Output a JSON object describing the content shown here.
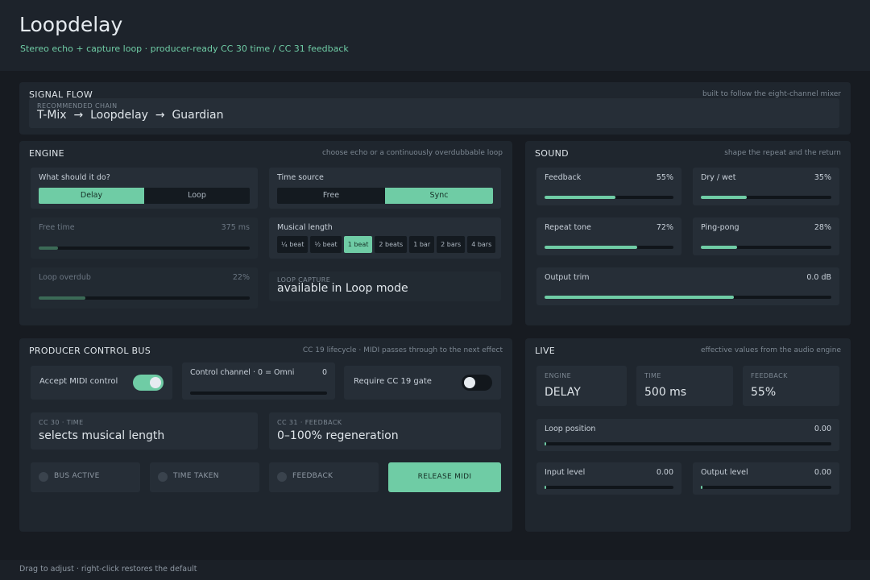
{
  "app": {
    "title": "Loopdelay",
    "subtitle": "Stereo echo + capture loop · producer-ready CC 30 time / CC 31 feedback"
  },
  "signal_flow": {
    "title": "SIGNAL FLOW",
    "hint": "built to follow the eight-channel mixer",
    "chain_label": "RECOMMENDED CHAIN",
    "chain": "T-Mix  →  Loopdelay  →  Guardian"
  },
  "engine": {
    "title": "ENGINE",
    "hint": "choose echo or a continuously overdubbable loop",
    "mode": {
      "label": "What should it do?",
      "options": [
        "Delay",
        "Loop"
      ],
      "selected": "Delay"
    },
    "time_source": {
      "label": "Time source",
      "options": [
        "Free",
        "Sync"
      ],
      "selected": "Sync"
    },
    "free_time": {
      "label": "Free time",
      "value": "375 ms",
      "level": 0.09
    },
    "musical_length": {
      "label": "Musical length",
      "options": [
        "¼ beat",
        "½ beat",
        "1 beat",
        "2 beats",
        "1 bar",
        "2 bars",
        "4 bars"
      ],
      "selected": "1 beat"
    },
    "loop_overdub": {
      "label": "Loop overdub",
      "value": "22%",
      "level": 0.22
    },
    "loop_capture": {
      "label": "LOOP CAPTURE",
      "value": "available in Loop mode"
    }
  },
  "sound": {
    "title": "SOUND",
    "hint": "shape the repeat and the return",
    "feedback": {
      "label": "Feedback",
      "value": "55%",
      "level": 0.55
    },
    "dry_wet": {
      "label": "Dry / wet",
      "value": "35%",
      "level": 0.35
    },
    "repeat_tone": {
      "label": "Repeat tone",
      "value": "72%",
      "level": 0.72
    },
    "ping_pong": {
      "label": "Ping-pong",
      "value": "28%",
      "level": 0.28
    },
    "output_trim": {
      "label": "Output trim",
      "value": "0.0 dB",
      "level": 0.66
    }
  },
  "bus": {
    "title": "PRODUCER CONTROL BUS",
    "hint": "CC 19 lifecycle · MIDI passes through to the next effect",
    "accept_midi": {
      "label": "Accept MIDI control",
      "on": true
    },
    "control_channel": {
      "label": "Control channel · 0 = Omni",
      "value": "0",
      "level": 0.0
    },
    "require_gate": {
      "label": "Require CC 19 gate",
      "on": false
    },
    "cc30": {
      "label": "CC 30 · TIME",
      "value": "selects musical length"
    },
    "cc31": {
      "label": "CC 31 · FEEDBACK",
      "value": "0–100% regeneration"
    },
    "leds": [
      "BUS ACTIVE",
      "TIME TAKEN",
      "FEEDBACK"
    ],
    "release_label": "RELEASE MIDI"
  },
  "live": {
    "title": "LIVE",
    "hint": "effective values from the audio engine",
    "engine": {
      "label": "ENGINE",
      "value": "DELAY"
    },
    "time": {
      "label": "TIME",
      "value": "500 ms"
    },
    "feedback": {
      "label": "FEEDBACK",
      "value": "55%"
    },
    "loop_position": {
      "label": "Loop position",
      "value": "0.00",
      "level": 0.0
    },
    "input_level": {
      "label": "Input level",
      "value": "0.00",
      "level": 0.0
    },
    "output_level": {
      "label": "Output level",
      "value": "0.00",
      "level": 0.0
    }
  },
  "footer": "Drag to adjust · right-click restores the default",
  "colors": {
    "accent": "#6fcca5",
    "background": "#171b21",
    "panel": "#1f262e"
  }
}
